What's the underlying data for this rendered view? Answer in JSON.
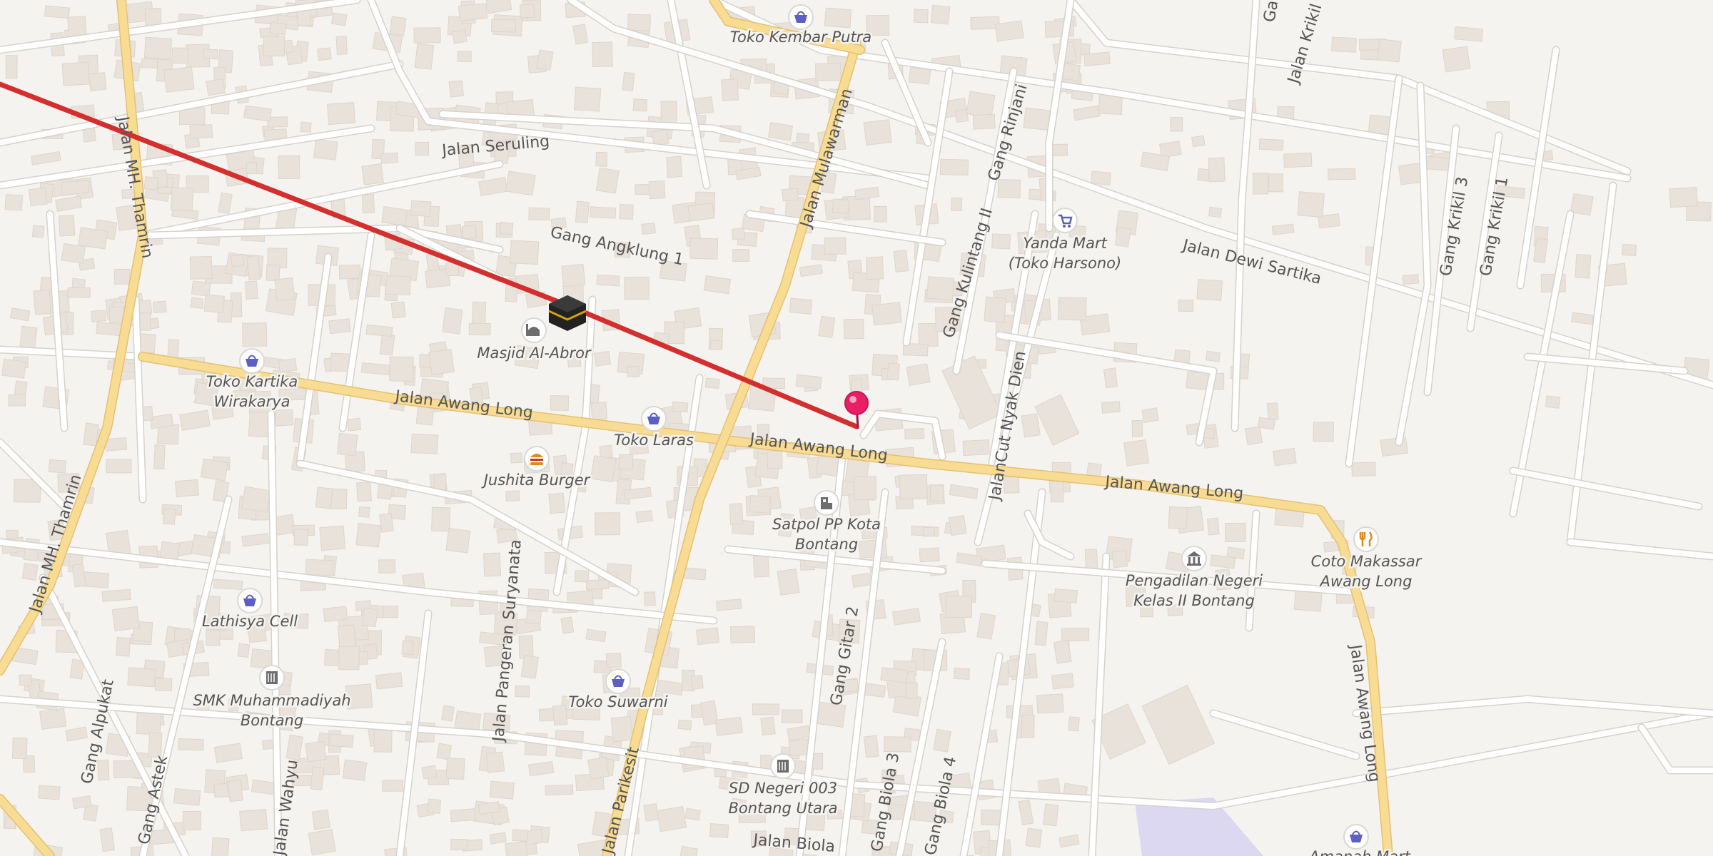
{
  "map": {
    "route_color": "#d32f2f",
    "pin_color": "#e91e63",
    "main_road_color": "#f8dc94",
    "main_road_casing": "#e6c071",
    "minor_road_color": "#ffffff",
    "minor_road_casing": "#d6d2cc",
    "building_color": "#e8e2da",
    "park_color": "#dcd8f2"
  },
  "streets": {
    "mh_thamrin_1": "Jalan MH. Thamrin",
    "mh_thamrin_2": "Jalan MH. Thamrin",
    "seruling": "Jalan Seruling",
    "angklung": "Gang Angklung 1",
    "mulawarman": "Jalan Mulawarman",
    "awang_long_1": "Jalan Awang Long",
    "awang_long_2": "Jalan Awang Long",
    "awang_long_3": "Jalan Awang Long",
    "awang_long_4": "Jalan Awang Long",
    "kulintang": "Gang Kulintang II",
    "rinjani": "Gang Rinjani",
    "cut_nyak_dien": "JalanCut Nyak Dien",
    "dewi_sartika": "Jalan Dewi Sartika",
    "krikil_3": "Gang Krikil 3",
    "krikil_1": "Gang Krikil 1",
    "krikil_top": "Jalan Krikil",
    "gang_top": "Ga",
    "suryanata": "Jalan Pangeran Suryanata",
    "parikesit": "Jalan Parikesit",
    "gitar": "Gang Gitar 2",
    "biola_3": "Gang Biola 3",
    "biola_4": "Gang Biola 4",
    "biola": "Jalan Biola",
    "alpukat": "Gang Alpukat",
    "astek": "Gang Astek",
    "wahyu": "Jalan Wahyu"
  },
  "pois": {
    "kembar_putra": "Toko Kembar Putra",
    "yanda_mart_1": "Yanda Mart",
    "yanda_mart_2": "(Toko Harsono)",
    "masjid": "Masjid Al-Abror",
    "kartika_1": "Toko Kartika",
    "kartika_2": "Wirakarya",
    "laras": "Toko Laras",
    "jushita": "Jushita Burger",
    "satpol_1": "Satpol PP Kota",
    "satpol_2": "Bontang",
    "pengadilan_1": "Pengadilan Negeri",
    "pengadilan_2": "Kelas II Bontang",
    "coto_1": "Coto Makassar",
    "coto_2": "Awang Long",
    "lathisya": "Lathisya Cell",
    "smk_1": "SMK Muhammadiyah",
    "smk_2": "Bontang",
    "suwarni": "Toko Suwarni",
    "sd_1": "SD Negeri 003",
    "sd_2": "Bontang Utara",
    "amanah": "Amanah Mart"
  },
  "icons": {
    "shop": "shopping-basket-icon",
    "cart": "shopping-cart-icon",
    "mosque": "mosque-icon",
    "kaaba": "kaaba-icon",
    "burger": "burger-icon",
    "police": "police-icon",
    "courthouse": "courthouse-icon",
    "restaurant": "fork-knife-icon",
    "school": "school-icon",
    "pin": "map-pin-icon"
  }
}
